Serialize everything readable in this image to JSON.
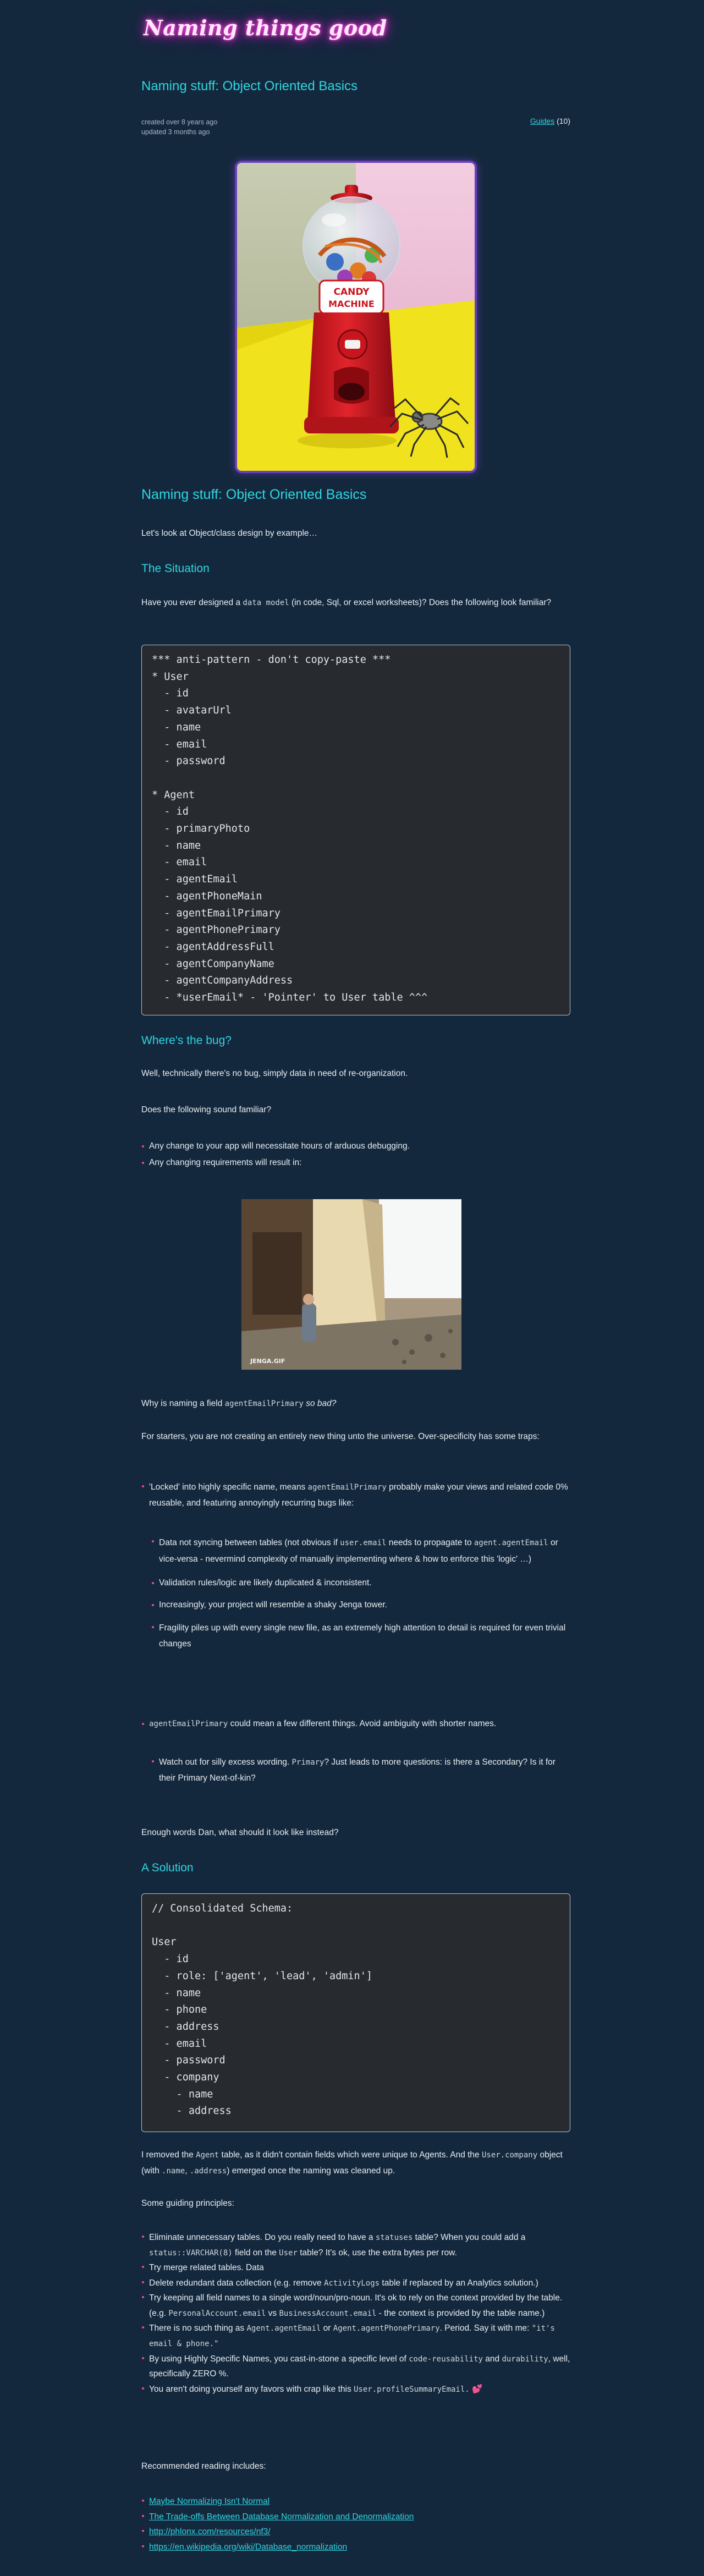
{
  "site": {
    "logo": "Naming things good"
  },
  "header": {
    "title": "Naming stuff: Object Oriented Basics",
    "created": "created over 8 years ago",
    "updated": "updated 3 months ago",
    "breadcrumb_link": "Guides",
    "breadcrumb_count": "(10)"
  },
  "hero": {
    "machine_label_1": "CANDY",
    "machine_label_2": "MACHINE"
  },
  "article": {
    "title": "Naming stuff: Object Oriented Basics",
    "intro": "Let's look at Object/class design by example…",
    "situation_heading": "The Situation",
    "situation_p1_a": "Have you ever designed a ",
    "situation_p1_code": "data model",
    "situation_p1_b": " (in code, Sql, or excel worksheets)? Does the following look familiar?",
    "code1": "*** anti-pattern - don't copy-paste ***\n* User\n  - id\n  - avatarUrl\n  - name\n  - email\n  - password\n\n* Agent\n  - id\n  - primaryPhoto\n  - name\n  - email\n  - agentEmail\n  - agentPhoneMain\n  - agentEmailPrimary\n  - agentPhonePrimary\n  - agentAddressFull\n  - agentCompanyName\n  - agentCompanyAddress\n  - *userEmail* - 'Pointer' to User table ^^^",
    "bug_heading": "Where's the bug?",
    "bug_p1": "Well, technically there's no bug, simply data in need of re-organization.",
    "bug_p2": "Does the following sound familiar?",
    "bug_list": [
      "Any change to your app will necessitate hours of arduous debugging.",
      "Any changing requirements will result in:"
    ],
    "gif_caption": "JENGA.GIF",
    "why_a": "Why is naming a field ",
    "why_code": "agentEmailPrimary",
    "why_b": " so bad?",
    "starters": "For starters, you are not creating an entirely new thing unto the universe. Over-specificity has some traps:",
    "locked_a": "'Locked' into highly specific name, means ",
    "locked_code": "agentEmailPrimary",
    "locked_b": " probably make your views and related code 0% reusable, and featuring annoyingly recurring bugs like:",
    "sub1_a": "Data not syncing between tables (not obvious if ",
    "sub1_code1": "user.email",
    "sub1_b": " needs to propagate to ",
    "sub1_code2": "agent.agentEmail",
    "sub1_c": " or vice-versa - nevermind complexity of manually implementing where & how to enforce this 'logic' …)",
    "sub2": "Validation rules/logic are likely duplicated & inconsistent.",
    "sub3": "Increasingly, your project will resemble a shaky Jenga tower.",
    "sub4": "Fragility piles up with every single new file, as an extremely high attention to detail is required for even trivial changes",
    "amb_code": "agentEmailPrimary",
    "amb_b": " could mean a few different things. Avoid ambiguity with shorter names.",
    "watch_a": "Watch out for silly excess wording. ",
    "watch_code": "Primary",
    "watch_b": "? Just leads to more questions: is there a Secondary? Is it for their Primary Next-of-kin?",
    "enough": "Enough words Dan, what should it look like instead?",
    "solution_heading": "A Solution",
    "code2": "// Consolidated Schema:\n\nUser\n  - id\n  - role: ['agent', 'lead', 'admin']\n  - name\n  - phone\n  - address\n  - email\n  - password\n  - company\n    - name\n    - address",
    "removed_a": "I removed the ",
    "removed_code1": "Agent",
    "removed_b": " table, as it didn't contain fields which were unique to Agents. And the ",
    "removed_code2": "User.company",
    "removed_c": " object (with ",
    "removed_code3": ".name",
    "removed_d": ", ",
    "removed_code4": ".address",
    "removed_e": ") emerged once the naming was cleaned up.",
    "principles": "Some guiding principles:",
    "p1_a": "Eliminate unnecessary tables. Do you really need to have a ",
    "p1_code1": "statuses",
    "p1_b": " table? When you could add a ",
    "p1_code2": "status::VARCHAR(8)",
    "p1_c": " field on the ",
    "p1_code3": "User",
    "p1_d": " table? It's ok, use the extra bytes per row.",
    "p2": "Try merge related tables. Data",
    "p3_a": "Delete redundant data collection (e.g. remove ",
    "p3_code": "ActivityLogs",
    "p3_b": " table if replaced by an Analytics solution.)",
    "p4_a": "Try keeping all field names to a single word/noun/pro-noun. It's ok to rely on the context provided by the table. (e.g. ",
    "p4_code1": "PersonalAccount.email",
    "p4_b": " vs ",
    "p4_code2": "BusinessAccount.email",
    "p4_c": " - the context is provided by the table name.)",
    "p5_a": "There is no such thing as ",
    "p5_code1": "Agent.agentEmail",
    "p5_b": " or ",
    "p5_code2": "Agent.agentPhonePrimary",
    "p5_c": ". Period. Say it with me: ",
    "p5_code3": "\"it's email & phone.\"",
    "p6_a": "By using Highly Specific Names, you cast-in-stone a specific level of ",
    "p6_code1": "code-reusability",
    "p6_b": " and ",
    "p6_code2": "durability",
    "p6_c": ", well, specifically ZERO %.",
    "p7_a": "You aren't doing yourself any favors with crap like this ",
    "p7_code": "User.profileSummaryEmail.",
    "p7_emoji": "💕",
    "reading": "Recommended reading includes:",
    "links": [
      "Maybe Normalizing Isn't Normal",
      "The Trade-offs Between Database Normalization and Denormalization",
      "http://phlonx.com/resources/nf3/",
      "https://en.wikipedia.org/wiki/Database_normalization"
    ]
  },
  "colors": {
    "background": "#14283d",
    "accent": "#2fd5e0",
    "bullet": "#e94e8a",
    "logo_glow": "#e33cc6"
  }
}
